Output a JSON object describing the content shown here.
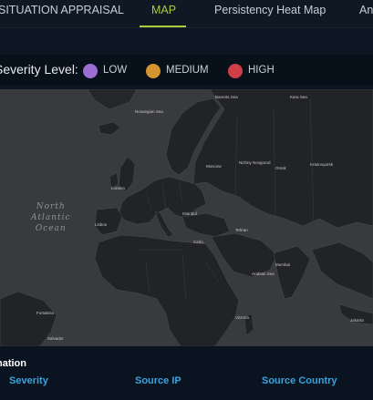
{
  "tabs": [
    {
      "label": "SITUATION APPRAISAL"
    },
    {
      "label": "MAP"
    },
    {
      "label": "Persistency Heat Map"
    },
    {
      "label": "An"
    }
  ],
  "active_tab": "MAP",
  "legend": {
    "title": "Severity Level:",
    "items": [
      {
        "label": "LOW",
        "color": "#9b6fd1"
      },
      {
        "label": "MEDIUM",
        "color": "#d4952f"
      },
      {
        "label": "HIGH",
        "color": "#d03f48"
      }
    ]
  },
  "map": {
    "ocean_label": [
      "North",
      "Atlantic",
      "Ocean"
    ],
    "places": [
      "London",
      "Moscow",
      "Nizhny Novgorod",
      "Omsk",
      "Krasnoyarsk",
      "Lisbon",
      "Istanbul",
      "Cairo",
      "Tehran",
      "Arabian Sea",
      "Mumbai",
      "Fortaleza",
      "Salvador",
      "Victoria",
      "Jakarta",
      "Norwegian Sea",
      "Barents Sea",
      "Kara Sea"
    ]
  },
  "events_table": {
    "title": "nation",
    "columns": [
      "Severity",
      "Source IP",
      "Source Country"
    ]
  }
}
